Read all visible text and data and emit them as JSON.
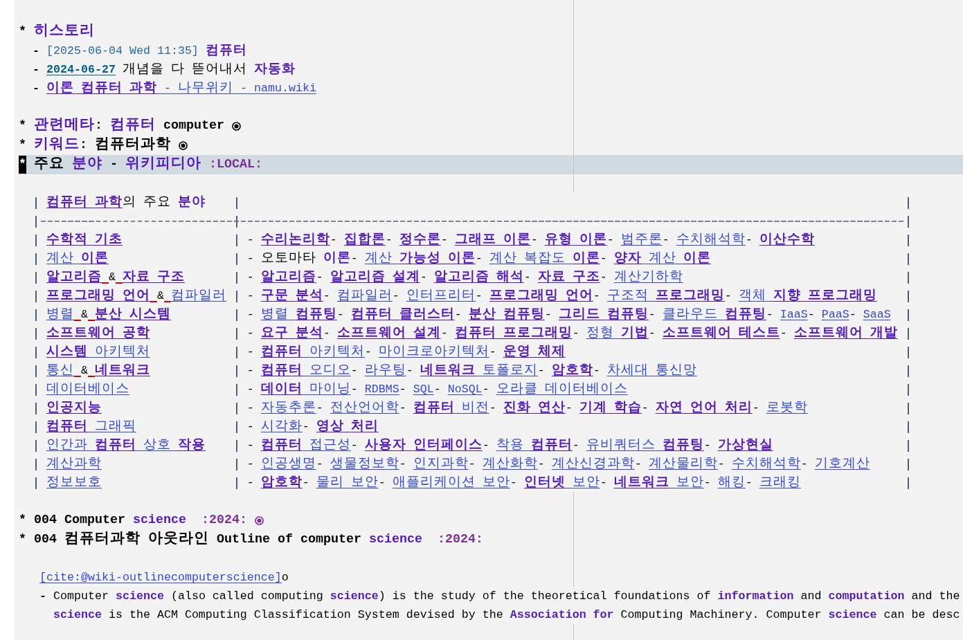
{
  "buffer": {
    "blocks": [
      {
        "kind": "heading",
        "stars": "*",
        "current": false,
        "folded": false,
        "segments": [
          {
            "kind": "keyword",
            "text": "히스토리"
          }
        ]
      },
      {
        "kind": "list",
        "items": [
          {
            "bullet": "-",
            "lines": [
              [
                {
                  "kind": "timestamp",
                  "text": "[2025-06-04 Wed 11:35]"
                },
                {
                  "kind": "keyword",
                  "text": " 컴퓨터"
                }
              ]
            ]
          },
          {
            "bullet": "-",
            "lines": [
              [
                {
                  "kind": "date-link",
                  "text": "2024-06-27"
                },
                {
                  "kind": "text",
                  "text": " 개념을 다 뜯어내서 "
                },
                {
                  "kind": "keyword",
                  "text": "자동화"
                }
              ]
            ]
          },
          {
            "bullet": "-",
            "lines": [
              [
                {
                  "kind": "link",
                  "text": "**이론 컴퓨터 과학** - 나무위키 - namu.wiki",
                  "bold": false
                }
              ]
            ]
          }
        ]
      },
      {
        "kind": "heading",
        "stars": "*",
        "current": false,
        "folded": true,
        "segments": [
          {
            "kind": "keyword",
            "text": "관련메타"
          },
          {
            "kind": "text",
            "text": ": "
          },
          {
            "kind": "keyword",
            "text": "컴퓨터"
          },
          {
            "kind": "text",
            "text": " computer"
          }
        ]
      },
      {
        "kind": "heading",
        "stars": "*",
        "current": false,
        "folded": true,
        "segments": [
          {
            "kind": "keyword",
            "text": "키워드"
          },
          {
            "kind": "text",
            "text": ": 컴퓨터과학"
          }
        ]
      },
      {
        "kind": "heading",
        "stars": "*",
        "current": true,
        "folded": false,
        "segments": [
          {
            "kind": "text",
            "text": "주요 "
          },
          {
            "kind": "keyword",
            "text": "분야"
          },
          {
            "kind": "text",
            "text": " - "
          },
          {
            "kind": "keyword",
            "text": "위키피디아"
          },
          {
            "kind": "tag",
            "text": " :LOCAL:"
          }
        ]
      },
      {
        "kind": "table",
        "header": [
          [
            {
              "kind": "link",
              "text": "컴퓨터 과학",
              "bold": true
            },
            {
              "kind": "text",
              "text": "의 주요 "
            },
            {
              "kind": "keyword",
              "text": "분야"
            }
          ]
        ],
        "rows": [
          {
            "cells": [
              [
                {
                  "kind": "link",
                  "text": "수학적 기초",
                  "bold": true
                }
              ],
              [
                {
                  "kind": "text",
                  "text": "- "
                },
                {
                  "kind": "link",
                  "text": "수리논리학",
                  "bold": true
                },
                {
                  "kind": "text",
                  "text": "- "
                },
                {
                  "kind": "link",
                  "text": "집합론",
                  "bold": true
                },
                {
                  "kind": "text",
                  "text": "- "
                },
                {
                  "kind": "link",
                  "text": "정수론",
                  "bold": true
                },
                {
                  "kind": "text",
                  "text": "- "
                },
                {
                  "kind": "link",
                  "text": "그래프 이론",
                  "bold": true
                },
                {
                  "kind": "text",
                  "text": "- "
                },
                {
                  "kind": "link",
                  "text": "유형 이론",
                  "bold": true
                },
                {
                  "kind": "text",
                  "text": "- "
                },
                {
                  "kind": "link",
                  "text": "범주론",
                  "bold": false
                },
                {
                  "kind": "text",
                  "text": "- "
                },
                {
                  "kind": "link",
                  "text": "수치해석학",
                  "bold": false
                },
                {
                  "kind": "text",
                  "text": "- "
                },
                {
                  "kind": "link",
                  "text": "이산수학",
                  "bold": true
                }
              ]
            ]
          },
          {
            "cells": [
              [
                {
                  "kind": "link",
                  "text": "계산 **이론**",
                  "bold": false
                }
              ],
              [
                {
                  "kind": "text",
                  "text": "- 오토마타 "
                },
                {
                  "kind": "keyword",
                  "text": "이론"
                },
                {
                  "kind": "text",
                  "text": "- "
                },
                {
                  "kind": "link",
                  "text": "계산 **가능성 이론**",
                  "bold": false
                },
                {
                  "kind": "text",
                  "text": "- "
                },
                {
                  "kind": "link",
                  "text": "계산 복잡도 **이론**",
                  "bold": false
                },
                {
                  "kind": "text",
                  "text": "- "
                },
                {
                  "kind": "link",
                  "text": "**양자** 계산 **이론**",
                  "bold": false
                }
              ]
            ]
          },
          {
            "cells": [
              [
                {
                  "kind": "link",
                  "text": "알고리즘",
                  "bold": true
                },
                {
                  "kind": "text",
                  "text": " & "
                },
                {
                  "kind": "link",
                  "text": "자료 구조",
                  "bold": true
                }
              ],
              [
                {
                  "kind": "text",
                  "text": "- "
                },
                {
                  "kind": "link",
                  "text": "알고리즘",
                  "bold": true
                },
                {
                  "kind": "text",
                  "text": "- "
                },
                {
                  "kind": "link",
                  "text": "알고리즘 설계",
                  "bold": true
                },
                {
                  "kind": "text",
                  "text": "- "
                },
                {
                  "kind": "link",
                  "text": "알고리즘 해석",
                  "bold": true
                },
                {
                  "kind": "text",
                  "text": "- "
                },
                {
                  "kind": "link",
                  "text": "자료 구조",
                  "bold": true
                },
                {
                  "kind": "text",
                  "text": "- "
                },
                {
                  "kind": "link",
                  "text": "계산기하학",
                  "bold": false
                }
              ]
            ]
          },
          {
            "cells": [
              [
                {
                  "kind": "link",
                  "text": "프로그래밍 언어",
                  "bold": true
                },
                {
                  "kind": "text",
                  "text": " & "
                },
                {
                  "kind": "link",
                  "text": "컴파일러",
                  "bold": false
                }
              ],
              [
                {
                  "kind": "text",
                  "text": "- "
                },
                {
                  "kind": "link",
                  "text": "구문 분석",
                  "bold": true
                },
                {
                  "kind": "text",
                  "text": "- "
                },
                {
                  "kind": "link",
                  "text": "컴파일러",
                  "bold": false
                },
                {
                  "kind": "text",
                  "text": "- "
                },
                {
                  "kind": "link",
                  "text": "인터프리터",
                  "bold": false
                },
                {
                  "kind": "text",
                  "text": "- "
                },
                {
                  "kind": "link",
                  "text": "프로그래밍 언어",
                  "bold": true
                },
                {
                  "kind": "text",
                  "text": "- "
                },
                {
                  "kind": "link",
                  "text": "구조적 **프로그래밍**",
                  "bold": false
                },
                {
                  "kind": "text",
                  "text": "- "
                },
                {
                  "kind": "link",
                  "text": "객체 **지향 프로그래밍**",
                  "bold": false
                }
              ]
            ]
          },
          {
            "cells": [
              [
                {
                  "kind": "link",
                  "text": "병렬",
                  "bold": false
                },
                {
                  "kind": "text",
                  "text": " & "
                },
                {
                  "kind": "link",
                  "text": "분산 시스템",
                  "bold": true
                }
              ],
              [
                {
                  "kind": "text",
                  "text": "- "
                },
                {
                  "kind": "link",
                  "text": "병렬 **컴퓨팅**",
                  "bold": false
                },
                {
                  "kind": "text",
                  "text": "- "
                },
                {
                  "kind": "link",
                  "text": "컴퓨터 클러스터",
                  "bold": true
                },
                {
                  "kind": "text",
                  "text": "- "
                },
                {
                  "kind": "link",
                  "text": "분산 컴퓨팅",
                  "bold": true
                },
                {
                  "kind": "text",
                  "text": "- "
                },
                {
                  "kind": "link",
                  "text": "그리드 컴퓨팅",
                  "bold": true
                },
                {
                  "kind": "text",
                  "text": "- "
                },
                {
                  "kind": "link",
                  "text": "클라우드 **컴퓨팅**",
                  "bold": false
                },
                {
                  "kind": "text",
                  "text": "- "
                },
                {
                  "kind": "link",
                  "text": "IaaS",
                  "bold": false
                },
                {
                  "kind": "text",
                  "text": "- "
                },
                {
                  "kind": "link",
                  "text": "PaaS",
                  "bold": false
                },
                {
                  "kind": "text",
                  "text": "- "
                },
                {
                  "kind": "link",
                  "text": "SaaS",
                  "bold": false
                }
              ]
            ]
          },
          {
            "cells": [
              [
                {
                  "kind": "link",
                  "text": "소프트웨어 공학",
                  "bold": true
                }
              ],
              [
                {
                  "kind": "text",
                  "text": "- "
                },
                {
                  "kind": "link",
                  "text": "요구 분석",
                  "bold": true
                },
                {
                  "kind": "text",
                  "text": "- "
                },
                {
                  "kind": "link",
                  "text": "소프트웨어 설계",
                  "bold": true
                },
                {
                  "kind": "text",
                  "text": "- "
                },
                {
                  "kind": "link",
                  "text": "컴퓨터 프로그래밍",
                  "bold": true
                },
                {
                  "kind": "text",
                  "text": "- "
                },
                {
                  "kind": "link",
                  "text": "정형 **기법**",
                  "bold": false
                },
                {
                  "kind": "text",
                  "text": "- "
                },
                {
                  "kind": "link",
                  "text": "소프트웨어 테스트",
                  "bold": true
                },
                {
                  "kind": "text",
                  "text": "- "
                },
                {
                  "kind": "link",
                  "text": "소프트웨어 개발",
                  "bold": true
                }
              ]
            ]
          },
          {
            "cells": [
              [
                {
                  "kind": "link",
                  "text": "**시스템** 아키텍처",
                  "bold": false
                }
              ],
              [
                {
                  "kind": "text",
                  "text": "- "
                },
                {
                  "kind": "link",
                  "text": "**컴퓨터** 아키텍처",
                  "bold": false
                },
                {
                  "kind": "text",
                  "text": "- "
                },
                {
                  "kind": "link",
                  "text": "마이크로아키텍처",
                  "bold": false
                },
                {
                  "kind": "text",
                  "text": "- "
                },
                {
                  "kind": "link",
                  "text": "운영 체제",
                  "bold": true
                }
              ]
            ]
          },
          {
            "cells": [
              [
                {
                  "kind": "link",
                  "text": "통신",
                  "bold": false
                },
                {
                  "kind": "text",
                  "text": " & "
                },
                {
                  "kind": "link",
                  "text": "네트워크",
                  "bold": true
                }
              ],
              [
                {
                  "kind": "text",
                  "text": "- "
                },
                {
                  "kind": "link",
                  "text": "**컴퓨터** 오디오",
                  "bold": false
                },
                {
                  "kind": "text",
                  "text": "- "
                },
                {
                  "kind": "link",
                  "text": "라우팅",
                  "bold": false
                },
                {
                  "kind": "text",
                  "text": "- "
                },
                {
                  "kind": "link",
                  "text": "**네트워크** 토폴로지",
                  "bold": false
                },
                {
                  "kind": "text",
                  "text": "- "
                },
                {
                  "kind": "link",
                  "text": "암호학",
                  "bold": true
                },
                {
                  "kind": "text",
                  "text": "- "
                },
                {
                  "kind": "link",
                  "text": "차세대 통신망",
                  "bold": false
                }
              ]
            ]
          },
          {
            "cells": [
              [
                {
                  "kind": "link",
                  "text": "데이터베이스",
                  "bold": false
                }
              ],
              [
                {
                  "kind": "text",
                  "text": "- "
                },
                {
                  "kind": "link",
                  "text": "**데이터** 마이닝",
                  "bold": false
                },
                {
                  "kind": "text",
                  "text": "- "
                },
                {
                  "kind": "link",
                  "text": "RDBMS",
                  "bold": false
                },
                {
                  "kind": "text",
                  "text": "- "
                },
                {
                  "kind": "link",
                  "text": "SQL",
                  "bold": false
                },
                {
                  "kind": "text",
                  "text": "- "
                },
                {
                  "kind": "link",
                  "text": "NoSQL",
                  "bold": false
                },
                {
                  "kind": "text",
                  "text": "- "
                },
                {
                  "kind": "link",
                  "text": "오라클 데이터베이스",
                  "bold": false
                }
              ]
            ]
          },
          {
            "cells": [
              [
                {
                  "kind": "link",
                  "text": "인공지능",
                  "bold": true
                }
              ],
              [
                {
                  "kind": "text",
                  "text": "- "
                },
                {
                  "kind": "link",
                  "text": "자동추론",
                  "bold": false
                },
                {
                  "kind": "text",
                  "text": "- "
                },
                {
                  "kind": "link",
                  "text": "전산언어학",
                  "bold": false
                },
                {
                  "kind": "text",
                  "text": "- "
                },
                {
                  "kind": "link",
                  "text": "**컴퓨터** 비전",
                  "bold": false
                },
                {
                  "kind": "text",
                  "text": "- "
                },
                {
                  "kind": "link",
                  "text": "진화 연산",
                  "bold": true
                },
                {
                  "kind": "text",
                  "text": "- "
                },
                {
                  "kind": "link",
                  "text": "기계 학습",
                  "bold": true
                },
                {
                  "kind": "text",
                  "text": "- "
                },
                {
                  "kind": "link",
                  "text": "자연 언어 처리",
                  "bold": true
                },
                {
                  "kind": "text",
                  "text": "- "
                },
                {
                  "kind": "link",
                  "text": "로봇학",
                  "bold": false
                }
              ]
            ]
          },
          {
            "cells": [
              [
                {
                  "kind": "link",
                  "text": "**컴퓨터** 그래픽",
                  "bold": false
                }
              ],
              [
                {
                  "kind": "text",
                  "text": "- "
                },
                {
                  "kind": "link",
                  "text": "시각화",
                  "bold": false
                },
                {
                  "kind": "text",
                  "text": "- "
                },
                {
                  "kind": "link",
                  "text": "영상 처리",
                  "bold": true
                }
              ]
            ]
          },
          {
            "cells": [
              [
                {
                  "kind": "link",
                  "text": "인간과 **컴퓨터** 상호 **작용**",
                  "bold": false
                }
              ],
              [
                {
                  "kind": "text",
                  "text": "- "
                },
                {
                  "kind": "link",
                  "text": "**컴퓨터** 접근성",
                  "bold": false
                },
                {
                  "kind": "text",
                  "text": "- "
                },
                {
                  "kind": "link",
                  "text": "사용자 인터페이스",
                  "bold": true
                },
                {
                  "kind": "text",
                  "text": "- "
                },
                {
                  "kind": "link",
                  "text": "착용 **컴퓨터**",
                  "bold": false
                },
                {
                  "kind": "text",
                  "text": "- "
                },
                {
                  "kind": "link",
                  "text": "유비쿼터스 **컴퓨팅**",
                  "bold": false
                },
                {
                  "kind": "text",
                  "text": "- "
                },
                {
                  "kind": "link",
                  "text": "가상현실",
                  "bold": true
                }
              ]
            ]
          },
          {
            "cells": [
              [
                {
                  "kind": "link",
                  "text": "계산과학",
                  "bold": false
                }
              ],
              [
                {
                  "kind": "text",
                  "text": "- "
                },
                {
                  "kind": "link",
                  "text": "인공생명",
                  "bold": false
                },
                {
                  "kind": "text",
                  "text": "- "
                },
                {
                  "kind": "link",
                  "text": "생물정보학",
                  "bold": false
                },
                {
                  "kind": "text",
                  "text": "- "
                },
                {
                  "kind": "link",
                  "text": "인지과학",
                  "bold": false
                },
                {
                  "kind": "text",
                  "text": "- "
                },
                {
                  "kind": "link",
                  "text": "계산화학",
                  "bold": false
                },
                {
                  "kind": "text",
                  "text": "- "
                },
                {
                  "kind": "link",
                  "text": "계산신경과학",
                  "bold": false
                },
                {
                  "kind": "text",
                  "text": "- "
                },
                {
                  "kind": "link",
                  "text": "계산물리학",
                  "bold": false
                },
                {
                  "kind": "text",
                  "text": "- "
                },
                {
                  "kind": "link",
                  "text": "수치해석학",
                  "bold": false
                },
                {
                  "kind": "text",
                  "text": "- "
                },
                {
                  "kind": "link",
                  "text": "기호계산",
                  "bold": false
                }
              ]
            ]
          },
          {
            "cells": [
              [
                {
                  "kind": "link",
                  "text": "정보보호",
                  "bold": false
                }
              ],
              [
                {
                  "kind": "text",
                  "text": "- "
                },
                {
                  "kind": "link",
                  "text": "암호학",
                  "bold": true
                },
                {
                  "kind": "text",
                  "text": "- "
                },
                {
                  "kind": "link",
                  "text": "물리 보안",
                  "bold": false
                },
                {
                  "kind": "text",
                  "text": "- "
                },
                {
                  "kind": "link",
                  "text": "애플리케이션 보안",
                  "bold": false
                },
                {
                  "kind": "text",
                  "text": "- "
                },
                {
                  "kind": "link",
                  "text": "**인터넷** 보안",
                  "bold": false
                },
                {
                  "kind": "text",
                  "text": "- "
                },
                {
                  "kind": "link",
                  "text": "**네트워크** 보안",
                  "bold": false
                },
                {
                  "kind": "text",
                  "text": "- "
                },
                {
                  "kind": "link",
                  "text": "해킹",
                  "bold": false
                },
                {
                  "kind": "text",
                  "text": "- "
                },
                {
                  "kind": "link",
                  "text": "크래킹",
                  "bold": false
                }
              ]
            ]
          }
        ]
      },
      {
        "kind": "heading",
        "stars": "*",
        "current": false,
        "folded": true,
        "segments": [
          {
            "kind": "text",
            "text": "004 Computer "
          },
          {
            "kind": "keyword",
            "text": "science"
          },
          {
            "kind": "tag",
            "text": "  :2024:"
          }
        ]
      },
      {
        "kind": "heading",
        "stars": "*",
        "current": false,
        "folded": false,
        "segments": [
          {
            "kind": "text",
            "text": "004 컴퓨터과학 아웃라인 Outline of computer "
          },
          {
            "kind": "keyword",
            "text": "science"
          },
          {
            "kind": "tag",
            "text": "  :2024:"
          }
        ]
      },
      {
        "kind": "cite",
        "segments": [
          {
            "kind": "link",
            "text": "[cite:@wiki-outlinecomputerscience]",
            "bold": false
          },
          {
            "kind": "text",
            "text": "o"
          }
        ]
      },
      {
        "kind": "list",
        "items": [
          {
            "bullet": "-",
            "lines": [
              [
                {
                  "kind": "text",
                  "text": "Computer "
                },
                {
                  "kind": "keyword",
                  "text": "science"
                },
                {
                  "kind": "text",
                  "text": " (also called computing "
                },
                {
                  "kind": "keyword",
                  "text": "science"
                },
                {
                  "kind": "text",
                  "text": ") is the study of the theoretical foundations of "
                },
                {
                  "kind": "keyword",
                  "text": "information"
                },
                {
                  "kind": "text",
                  "text": " and "
                },
                {
                  "kind": "keyword",
                  "text": "computation"
                },
                {
                  "kind": "text",
                  "text": " and the"
                }
              ],
              [
                {
                  "kind": "keyword",
                  "text": "science"
                },
                {
                  "kind": "text",
                  "text": " is the ACM Computing Classification System devised by the "
                },
                {
                  "kind": "keyword",
                  "text": "Association for"
                },
                {
                  "kind": "text",
                  "text": " Computing Machinery. Computer "
                },
                {
                  "kind": "keyword",
                  "text": "science"
                },
                {
                  "kind": "text",
                  "text": " can be desc"
                }
              ]
            ]
          }
        ]
      }
    ]
  }
}
